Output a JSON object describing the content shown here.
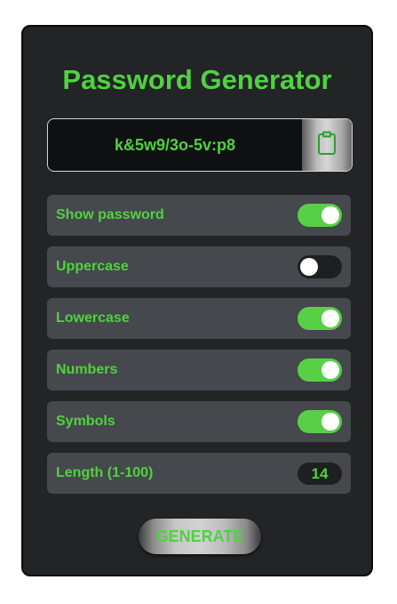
{
  "app": {
    "title": "Password Generator"
  },
  "password": {
    "value": "k&5w9/3o-5v:p8"
  },
  "copy_button": {
    "icon": "clipboard-icon"
  },
  "options": [
    {
      "label": "Show password",
      "enabled": true
    },
    {
      "label": "Uppercase",
      "enabled": false
    },
    {
      "label": "Lowercase",
      "enabled": true
    },
    {
      "label": "Numbers",
      "enabled": true
    },
    {
      "label": "Symbols",
      "enabled": true
    }
  ],
  "length": {
    "label": "Length (1-100)",
    "value": "14"
  },
  "generate_button": {
    "label": "GENERATE"
  },
  "colors": {
    "accent": "#4fd33f",
    "toggle_on": "#57d046",
    "card_bg": "#222426",
    "row_bg": "#45484c"
  }
}
